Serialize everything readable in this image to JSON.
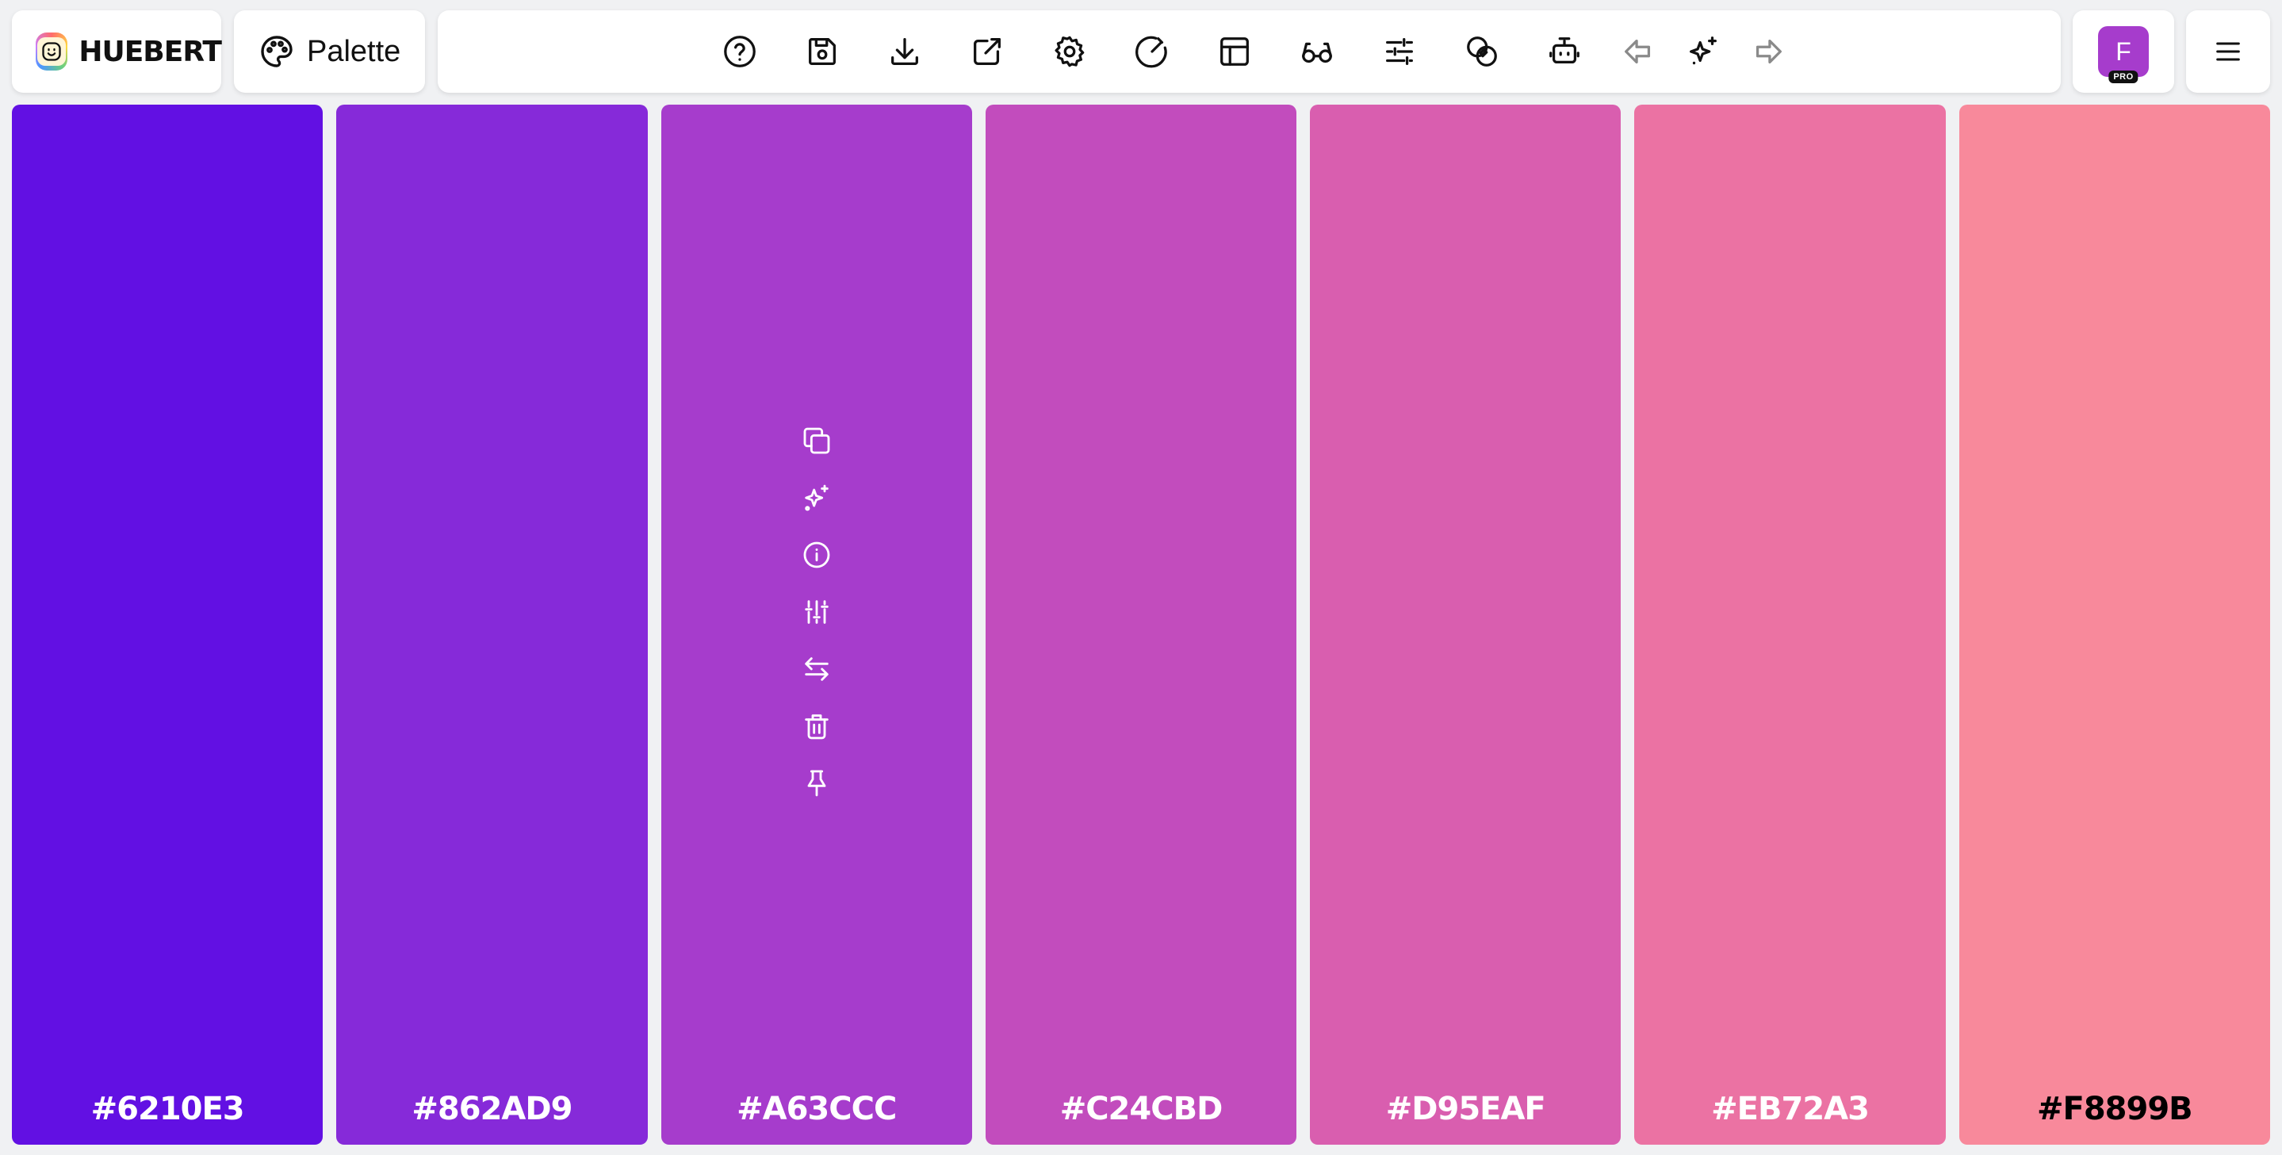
{
  "brand": {
    "name": "HUEBERT",
    "icon": "huebert-logo-icon"
  },
  "mode": {
    "label": "Palette",
    "icon": "palette-icon"
  },
  "toolbar": {
    "icons": [
      "help-icon",
      "save-icon",
      "download-icon",
      "export-icon",
      "settings-icon",
      "contrast-checker-icon",
      "layout-icon",
      "visualize-icon",
      "adjustments-icon",
      "color-blend-icon",
      "ai-bot-icon",
      "undo-icon",
      "generate-sparkle-icon",
      "redo-icon"
    ]
  },
  "user": {
    "initial": "F",
    "badge": "PRO",
    "avatar_color": "#A63CCC"
  },
  "menu": {
    "icon": "hamburger-menu-icon"
  },
  "palette": {
    "colors": [
      {
        "hex": "#6210E3",
        "color": "#6210E3",
        "text_color": "light"
      },
      {
        "hex": "#862AD9",
        "color": "#862AD9",
        "text_color": "light"
      },
      {
        "hex": "#A63CCC",
        "color": "#A63CCC",
        "text_color": "light"
      },
      {
        "hex": "#C24CBD",
        "color": "#C24CBD",
        "text_color": "light"
      },
      {
        "hex": "#D95EAF",
        "color": "#D95EAF",
        "text_color": "light"
      },
      {
        "hex": "#EB72A3",
        "color": "#EB72A3",
        "text_color": "light"
      },
      {
        "hex": "#F8899B",
        "color": "#F8899B",
        "text_color": "dark"
      }
    ],
    "hovered_swatch_actions": [
      "copy-icon",
      "sparkle-icon",
      "info-icon",
      "adjust-icon",
      "swap-icon",
      "trash-icon",
      "pin-icon"
    ]
  }
}
